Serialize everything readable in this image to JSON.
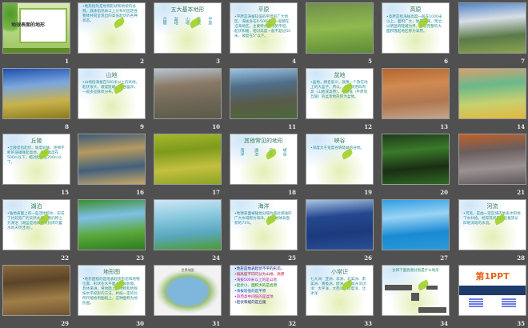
{
  "slides": [
    {
      "num": "1",
      "type": "cover",
      "title": "地球表面的地形"
    },
    {
      "num": "2",
      "type": "text",
      "title": "",
      "body": "•地形指的是地物形状和地貌的总称，具体指地表以上分布的固定性物体共同呈现出的高低起伏的各种状态。"
    },
    {
      "num": "3",
      "type": "cols",
      "title": "五大基本地形",
      "items": [
        "丘陵",
        "盆地",
        "山地",
        "高原",
        "平原"
      ]
    },
    {
      "num": "4",
      "type": "text",
      "title": "平原",
      "body": "•平原是海拔较低的平坦的广大地区，海拔多在0-500米，一般都在沿海地区。主要特点是地势平坦，起伏和缓，相对高度一般不超过50米，坡度在5°以下。"
    },
    {
      "num": "5",
      "type": "photo",
      "colors": [
        "#6f8f4a",
        "#8fba4e",
        "#5e8a36"
      ]
    },
    {
      "num": "6",
      "type": "text",
      "title": "高原",
      "body": "•高原是指海拔高度一般在1000米以上，面积广大，地形开阔，周边以明显的陡坡为界，比较完整的大面积隆起地区称为高原。"
    },
    {
      "num": "7",
      "type": "photo",
      "colors": [
        "#4d82c4",
        "#d8dee6",
        "#5a7a48",
        "#8aa450"
      ]
    },
    {
      "num": "8",
      "type": "photo",
      "colors": [
        "#1c4fae",
        "#7aa6de",
        "#c9b24a",
        "#8a7a1e"
      ]
    },
    {
      "num": "9",
      "type": "text",
      "title": "山地",
      "body": "•山地指海拔在500米以上的高地，起伏很大，坡度陡峻，沟谷幽深，一般多呈脉状分布。"
    },
    {
      "num": "10",
      "type": "photo",
      "colors": [
        "#b8c4d2",
        "#8a7a66",
        "#6e6656",
        "#5c5a48"
      ]
    },
    {
      "num": "11",
      "type": "photo",
      "colors": [
        "#9cc4e2",
        "#4e6e8a",
        "#5a5a48",
        "#4a6a3a"
      ]
    },
    {
      "num": "12",
      "type": "text",
      "title": "盆地",
      "body": "•盆地，顾名思义，就像一个放在地上的大盆子。所以，人们就把四周高（山地或高原）、中部低（平原或丘陵）的盆状地形称为盆地。"
    },
    {
      "num": "13",
      "type": "photo",
      "colors": [
        "#b5652e",
        "#d08a52",
        "#b07850",
        "#c4a48e"
      ]
    },
    {
      "num": "14",
      "type": "photo",
      "colors": [
        "#d8a070",
        "#6ab88a",
        "#c8d070",
        "#e0b840"
      ]
    },
    {
      "num": "15",
      "type": "text",
      "title": "丘陵",
      "body": "•丘陵是指起伏、坡度较缓、连绵不断的低矮隆起高地，海拔高度在500m以下，相对起伏在200m以下。"
    },
    {
      "num": "16",
      "type": "photo",
      "colors": [
        "#3c5a7a",
        "#b59a60",
        "#42607c",
        "#c8a868"
      ]
    },
    {
      "num": "17",
      "type": "photo",
      "colors": [
        "#a4b82c",
        "#7e9a1c",
        "#c4c040",
        "#8aa424"
      ]
    },
    {
      "num": "18",
      "type": "cols",
      "title": "其他常见的地形",
      "items": [
        "海洋",
        "湖泊",
        "河流",
        "峡谷"
      ]
    },
    {
      "num": "19",
      "type": "text",
      "title": "峡谷",
      "body": "•深度大于宽度谷坡陡峭的谷地。"
    },
    {
      "num": "20",
      "type": "photo",
      "colors": [
        "#1e3a1a",
        "#3a7a2a",
        "#1a2e14",
        "#2e6a22"
      ]
    },
    {
      "num": "21",
      "type": "photo",
      "colors": [
        "#c0602a",
        "#6a5e5c",
        "#9a9294",
        "#5e5656"
      ]
    },
    {
      "num": "22",
      "type": "text",
      "title": "湖泊",
      "body": "•陆地表面上有一些洼地积水，形成了比较宽广的天然水域，我们称之为湖泊（湖盆是地表相对封闭可蓄水的天然洼池）。"
    },
    {
      "num": "23",
      "type": "photo",
      "colors": [
        "#3e8e2e",
        "#7ec0e8",
        "#5aa83a",
        "#2e7a22"
      ]
    },
    {
      "num": "24",
      "type": "photo",
      "colors": [
        "#cfe6f4",
        "#8ccbe0",
        "#5aa8c0",
        "#4e9a34"
      ]
    },
    {
      "num": "25",
      "type": "text",
      "title": "海洋",
      "body": "•地球表面被陆地分隔为彼此相通的广大水域称为海洋，约占地球表面积的71%。"
    },
    {
      "num": "26",
      "type": "photo",
      "colors": [
        "#a8c4e4",
        "#24488e",
        "#1c3a7e",
        "#2c4e94"
      ]
    },
    {
      "num": "27",
      "type": "photo",
      "colors": [
        "#2e9ee2",
        "#9ad4f4",
        "#1a8ad4",
        "#2a9ad8"
      ]
    },
    {
      "num": "28",
      "type": "text",
      "title": "河流",
      "body": "•河流，是由一定区域内地表水和地下水补给，经常或间歇地沿着狭长凹地流动的水流。"
    },
    {
      "num": "29",
      "type": "photo",
      "colors": [
        "#8a6a3a",
        "#5a4428",
        "#a07e48",
        "#6e5434"
      ]
    },
    {
      "num": "30",
      "type": "text",
      "title": "地形图",
      "body": "•地形图指的是地表起伏形态和地物位置、形状在水平面上的投影图。具体来讲，将地面上的地物和地貌按水平投影的方法，并按一定的比例尺缩绘到图纸上，这种图称为地形图。"
    },
    {
      "num": "31",
      "type": "map",
      "title": "世界地图"
    },
    {
      "num": "32",
      "type": "mixed",
      "lines": [
        "•地形是地表起伏不平的形态。",
        "•按高度不同可分为山地、高原",
        "•海拔500米以上的是山地",
        "•起伏小、面积大的是高原",
        "•海拔较低的是平原",
        "•四周高中间低的是盆地",
        "•起伏和缓的是丘陵"
      ]
    },
    {
      "num": "33",
      "type": "text",
      "title": "小常识",
      "body": "七大洲：亚洲、非洲、北美洲、南美洲、南极洲、欧洲、大洋洲 四大洋：太平洋、大西洋、印度洋、北冰洋"
    },
    {
      "num": "34",
      "type": "quiz",
      "title": "分辨下面各图分别是什么地形"
    },
    {
      "num": "35",
      "type": "logo",
      "logo": "第1PPT"
    }
  ]
}
